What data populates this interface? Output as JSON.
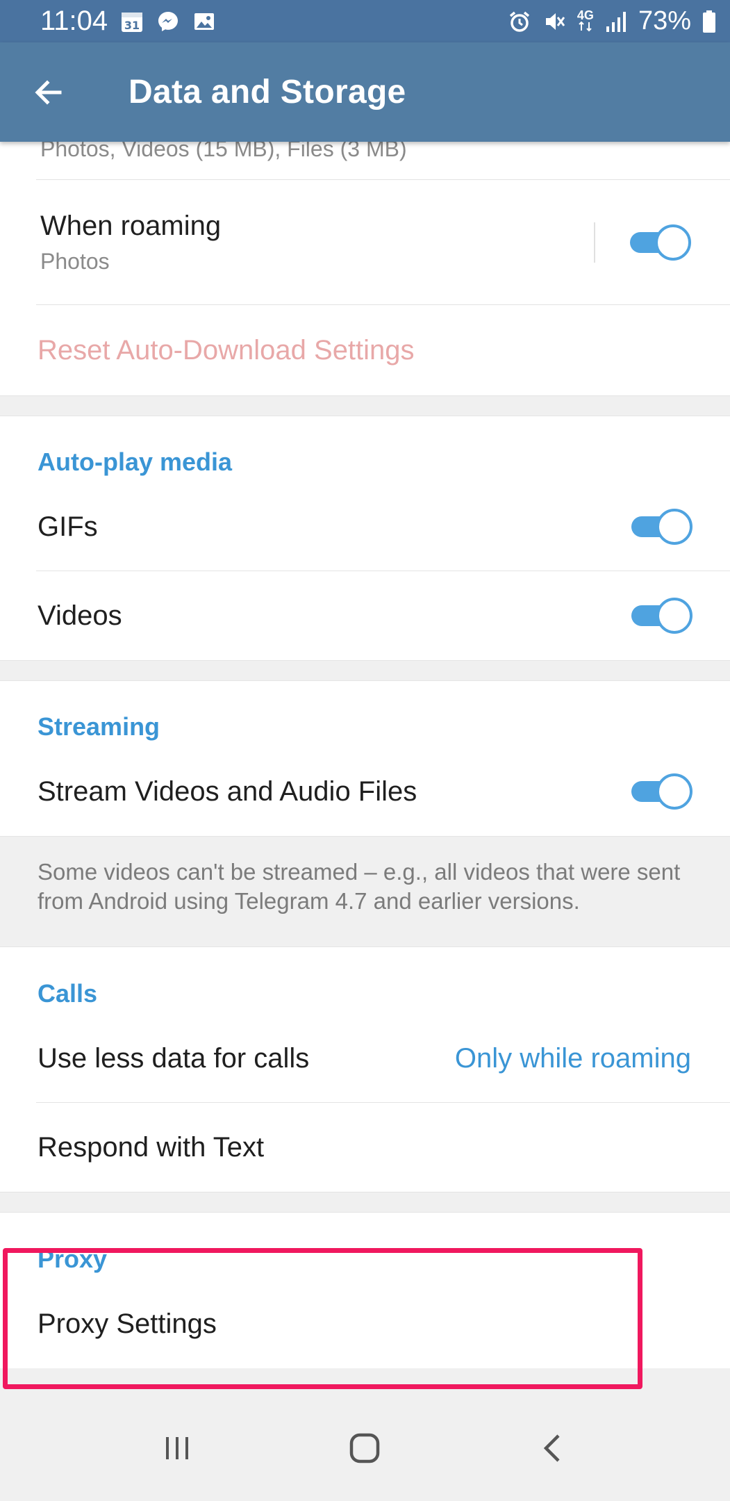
{
  "status_bar": {
    "time": "11:04",
    "calendar_day": "31",
    "network_type": "4G",
    "battery": "73%"
  },
  "app_bar": {
    "title": "Data and Storage"
  },
  "auto_download": {
    "partial_text": "Photos, Videos (15 MB), Files (3 MB)",
    "roaming": {
      "label": "When roaming",
      "value": "Photos",
      "enabled": true
    },
    "reset_label": "Reset Auto-Download Settings"
  },
  "autoplay": {
    "header": "Auto-play media",
    "items": [
      {
        "label": "GIFs",
        "enabled": true
      },
      {
        "label": "Videos",
        "enabled": true
      }
    ]
  },
  "streaming": {
    "header": "Streaming",
    "item": {
      "label": "Stream Videos and Audio Files",
      "enabled": true
    },
    "info": "Some videos can't be streamed – e.g., all videos that were sent from Android using Telegram 4.7 and earlier versions."
  },
  "calls": {
    "header": "Calls",
    "less_data": {
      "label": "Use less data for calls",
      "value": "Only while roaming"
    },
    "respond": {
      "label": "Respond with Text"
    }
  },
  "proxy": {
    "header": "Proxy",
    "settings_label": "Proxy Settings"
  },
  "colors": {
    "app_bar": "#527da3",
    "status_bar": "#4a73a0",
    "accent": "#3a95d5",
    "toggle": "#4fa3e0",
    "reset_text": "#e8a8a8",
    "highlight": "#f0185e"
  },
  "icons": {
    "back": "arrow-left-icon",
    "nav_recents": "recents-icon",
    "nav_home": "home-icon",
    "nav_back": "chevron-left-icon"
  }
}
